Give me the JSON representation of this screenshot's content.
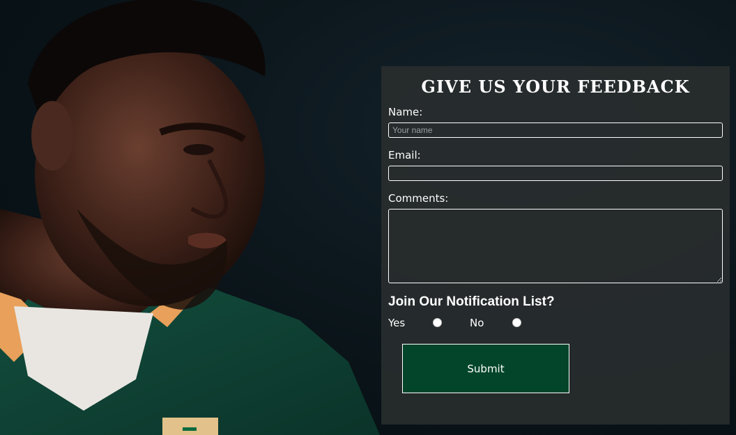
{
  "feedback_form": {
    "title": "GIVE US YOUR FEEDBACK",
    "name_label": "Name:",
    "name_placeholder": "Your name",
    "name_value": "",
    "email_label": "Email:",
    "email_value": "",
    "comments_label": "Comments:",
    "comments_value": "",
    "notification_heading": "Join Our Notification List?",
    "option_yes": "Yes",
    "option_no": "No",
    "selected_option": "",
    "submit_label": "Submit"
  },
  "colors": {
    "panel_background": "#282c2e",
    "submit_background": "#02452a",
    "text": "#ffffff",
    "jersey_green": "#0f4a3a",
    "collar_orange": "#e8a05a"
  }
}
